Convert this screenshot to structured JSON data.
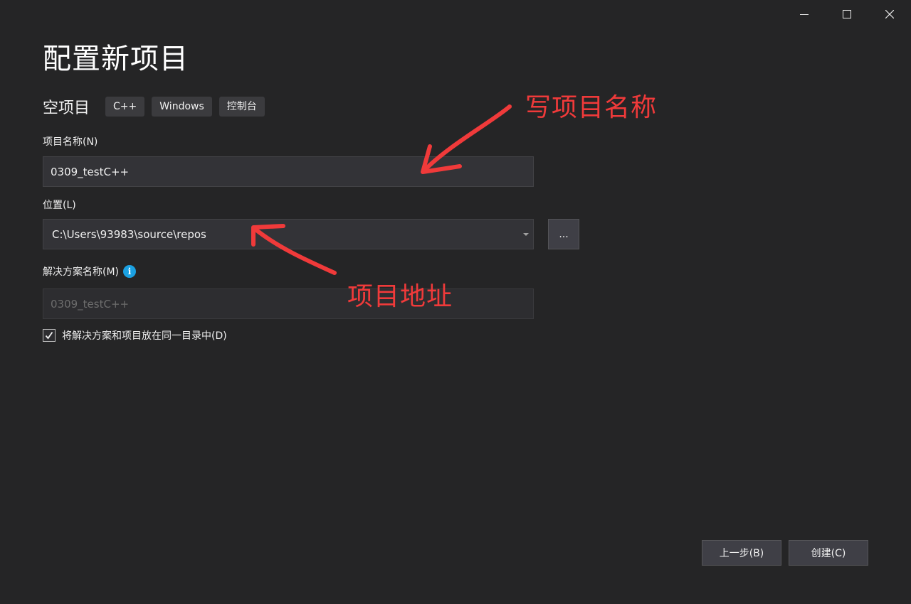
{
  "window_controls": {
    "minimize": "minimize",
    "maximize": "maximize",
    "close": "close"
  },
  "page_title": "配置新项目",
  "template": {
    "name": "空项目",
    "tags": [
      "C++",
      "Windows",
      "控制台"
    ]
  },
  "project_name": {
    "label": "项目名称(N)",
    "value": "0309_testC++"
  },
  "location": {
    "label": "位置(L)",
    "value": "C:\\Users\\93983\\source\\repos",
    "browse_label": "..."
  },
  "solution_name": {
    "label": "解决方案名称(M)",
    "info_icon": "i",
    "value": "0309_testC++"
  },
  "same_dir_checkbox": {
    "label": "将解决方案和项目放在同一目录中(D)",
    "checked": true
  },
  "footer": {
    "back_label": "上一步(B)",
    "create_label": "创建(C)"
  },
  "annotations": {
    "name_note": "写项目名称",
    "location_note": "项目地址",
    "color": "#f03a3a"
  }
}
